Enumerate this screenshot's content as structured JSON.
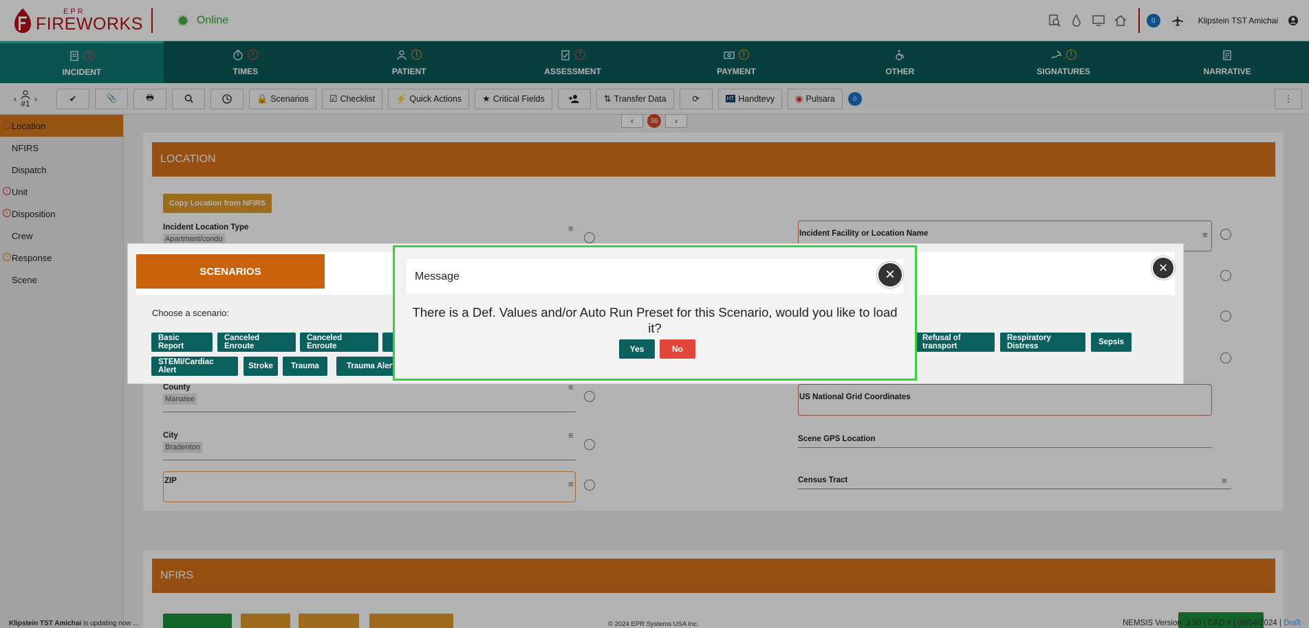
{
  "app": {
    "logo_top": "EPR",
    "logo_main": "FIREWORKS",
    "status": "Online",
    "chat_count": "0",
    "user_name": "Klipstein TST Amichai"
  },
  "nav": {
    "tabs": [
      {
        "label": "INCIDENT",
        "icon": "clipboard-icon",
        "warn": "red",
        "active": true
      },
      {
        "label": "TIMES",
        "icon": "stopwatch-icon",
        "warn": "red",
        "active": false
      },
      {
        "label": "PATIENT",
        "icon": "person-icon",
        "warn": "amber",
        "active": false
      },
      {
        "label": "ASSESSMENT",
        "icon": "clipboard-check-icon",
        "warn": "red",
        "active": false
      },
      {
        "label": "PAYMENT",
        "icon": "money-icon",
        "warn": "amber",
        "active": false
      },
      {
        "label": "OTHER",
        "icon": "wheelchair-icon",
        "warn": "",
        "active": false
      },
      {
        "label": "SIGNATURES",
        "icon": "signature-icon",
        "warn": "amber",
        "active": false
      },
      {
        "label": "NARRATIVE",
        "icon": "document-icon",
        "warn": "",
        "active": false
      }
    ]
  },
  "toolbar": {
    "patient_number": "#1",
    "scenarios": "Scenarios",
    "checklist": "Checklist",
    "quick_actions": "Quick Actions",
    "critical_fields": "Critical Fields",
    "transfer_data": "Transfer Data",
    "handtevy": "Handtevy",
    "pulsara": "Pulsara",
    "chat_count": "0"
  },
  "sidebar": {
    "items": [
      {
        "label": "Location",
        "warn": "red",
        "active": true
      },
      {
        "label": "NFIRS",
        "warn": "",
        "active": false
      },
      {
        "label": "Dispatch",
        "warn": "",
        "active": false
      },
      {
        "label": "Unit",
        "warn": "red",
        "active": false
      },
      {
        "label": "Disposition",
        "warn": "red",
        "active": false
      },
      {
        "label": "Crew",
        "warn": "",
        "active": false
      },
      {
        "label": "Response",
        "warn": "amber",
        "active": false
      },
      {
        "label": "Scene",
        "warn": "",
        "active": false
      }
    ]
  },
  "pager": {
    "count": "36"
  },
  "location": {
    "section_title": "LOCATION",
    "copy_button": "Copy Location from NFIRS",
    "fields": {
      "incident_location_type": {
        "label": "Incident Location Type",
        "value": "Apartment/condo"
      },
      "county": {
        "label": "County",
        "value": "Manatee"
      },
      "city": {
        "label": "City",
        "value": "Bradenton"
      },
      "zip": {
        "label": "ZIP",
        "value": ""
      },
      "facility_name": {
        "label": "Incident Facility or Location Name",
        "value": ""
      },
      "us_grid": {
        "label": "US National Grid Coordinates",
        "value": ""
      },
      "scene_gps": {
        "label": "Scene GPS Location",
        "value": ""
      },
      "census_tract": {
        "label": "Census Tract",
        "value": ""
      }
    }
  },
  "nfirs": {
    "section_title": "NFIRS"
  },
  "scenarios_modal": {
    "title": "SCENARIOS",
    "prompt": "Choose a scenario:",
    "buttons_row1": [
      "Basic Report",
      "Canceled Enroute",
      "Canceled Enroute"
    ],
    "buttons_row1_right": [
      "Refusal of transport",
      "Respiratory Distress",
      "Sepsis"
    ],
    "buttons_row2": [
      "STEMI/Cardiac Alert",
      "Stroke",
      "Trauma",
      "Trauma Alert"
    ]
  },
  "message": {
    "title": "Message",
    "text": "There is a Def. Values and/or Auto Run Preset for this Scenario, would you like to load it?",
    "yes": "Yes",
    "no": "No"
  },
  "footer": {
    "left_user": "Klipstein TST Amichai",
    "left_status": " is updating now ...",
    "center": "© 2024 EPR Systems USA Inc.",
    "right_prefix": "NEMSIS Version: 3.50 | CAD # | 09/04/2024 | ",
    "right_draft": "Draft"
  },
  "colors": {
    "brand_red": "#b5121b",
    "nav_teal": "#0b5a59",
    "section_orange": "#d9701a",
    "scenario_button": "#0b5f5c",
    "no_button": "#e0463a",
    "dialog_border": "#39d23a"
  }
}
